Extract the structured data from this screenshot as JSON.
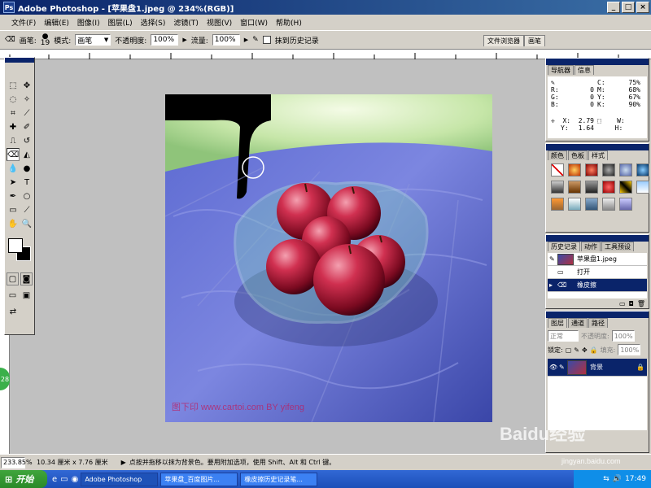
{
  "window": {
    "title": "Adobe Photoshop - [苹果盘1.jpeg @ 234%(RGB)]",
    "app_icon_label": "Ps"
  },
  "menu": [
    "文件(F)",
    "编辑(E)",
    "图像(I)",
    "图层(L)",
    "选择(S)",
    "滤镜(T)",
    "视图(V)",
    "窗口(W)",
    "帮助(H)"
  ],
  "options": {
    "brush_label": "画笔:",
    "brush_size": "19",
    "mode_label": "模式:",
    "mode_value": "画笔",
    "opacity_label": "不透明度:",
    "opacity_value": "100%",
    "flow_label": "流量:",
    "flow_value": "100%",
    "erase_history_label": "抹到历史记录",
    "tab_file_browser": "文件浏览器",
    "tab_brushes": "画笔"
  },
  "image": {
    "photo_watermark": "图下印 www.cartoi.com BY yifeng"
  },
  "panels": {
    "navigator": {
      "tabs": [
        "导航器",
        "信息"
      ],
      "rgb": [
        {
          "k": "R:",
          "v": "0"
        },
        {
          "k": "G:",
          "v": "0"
        },
        {
          "k": "B:",
          "v": "0"
        }
      ],
      "cmyk": [
        {
          "k": "C:",
          "v": "75%"
        },
        {
          "k": "M:",
          "v": "68%"
        },
        {
          "k": "Y:",
          "v": "67%"
        },
        {
          "k": "K:",
          "v": "90%"
        }
      ],
      "xy": [
        {
          "k": "X:",
          "v": "2.79"
        },
        {
          "k": "Y:",
          "v": "1.64"
        }
      ],
      "wh": [
        {
          "k": "W:",
          "v": ""
        },
        {
          "k": "H:",
          "v": ""
        }
      ]
    },
    "color": {
      "tabs": [
        "颜色",
        "色板",
        "样式"
      ]
    },
    "history": {
      "tabs": [
        "历史记录",
        "动作",
        "工具预设"
      ],
      "items": [
        "苹果盘1.jpeg",
        "打开",
        "橡皮擦"
      ]
    },
    "layers": {
      "tabs": [
        "图层",
        "通道",
        "路径"
      ],
      "blend_mode": "正常",
      "opacity_label": "不透明度:",
      "opacity_value": "100%",
      "lock_label": "锁定:",
      "fill_label": "填充:",
      "fill_value": "100%",
      "layer_name": "背景"
    }
  },
  "status": {
    "zoom": "233.85%",
    "doc_size": "10.34 厘米 x 7.76 厘米",
    "hint": "点按并拖移以抹为背景色。要用附加选项，使用 Shift、Alt 和 Ctrl 键。"
  },
  "taskbar": {
    "start": "开始",
    "tasks": [
      "Adobe Photoshop",
      "苹果盘_百度图片...",
      "橡皮擦历史记录笔..."
    ],
    "time": "17:49"
  },
  "watermark": {
    "brand": "Baidu经验",
    "url": "jingyan.baidu.com"
  },
  "side_badge": "28"
}
